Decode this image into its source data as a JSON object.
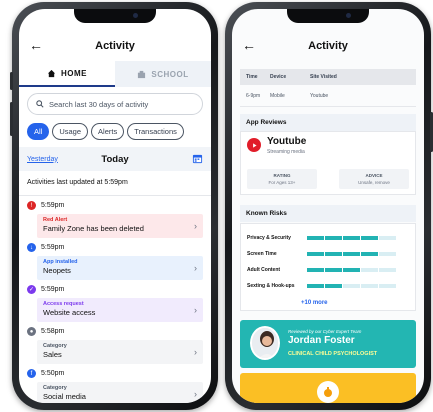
{
  "left": {
    "header": {
      "title": "Activity"
    },
    "tabs": [
      {
        "label": "HOME"
      },
      {
        "label": "SCHOOL"
      }
    ],
    "search": {
      "placeholder": "Search last 30 days of activity"
    },
    "filters": [
      "All",
      "Usage",
      "Alerts",
      "Transactions"
    ],
    "date_nav": {
      "prev": "Yesterday",
      "current": "Today"
    },
    "updated_text": "Activities last updated at 5:59pm",
    "feed": [
      {
        "time": "5:59pm",
        "label": "Red Alert",
        "value": "Family Zone has been deleted",
        "color": "#dc2626",
        "bg": "#fde8ea"
      },
      {
        "time": "5:59pm",
        "label": "App installed",
        "value": "Neopets",
        "color": "#2563eb",
        "bg": "#e8f1fd"
      },
      {
        "time": "5:59pm",
        "label": "Access request",
        "value": "Website access",
        "color": "#7c3aed",
        "bg": "#f1ebfd"
      },
      {
        "time": "5:58pm",
        "label": "Category",
        "value": "Sales",
        "color": "#6b7280",
        "bg": "#f3f4f6"
      },
      {
        "time": "5:50pm",
        "label": "Category",
        "value": "Social media",
        "color": "#2563eb",
        "bg": "#f3f4f6"
      }
    ]
  },
  "right": {
    "header": {
      "title": "Activity"
    },
    "table": {
      "headers": [
        "Time",
        "Device",
        "Site Visited"
      ],
      "rows": [
        [
          "6-9pm",
          "Mobile",
          "Youtube"
        ]
      ]
    },
    "reviews": {
      "heading": "App Reviews",
      "app_name": "Youtube",
      "app_sub": "Streaming media",
      "rating_h": "RATING",
      "rating_v": "For Ages 13+",
      "advice_h": "ADVICE",
      "advice_v": "Unsafe, remove"
    },
    "risks": {
      "heading": "Known Risks",
      "items": [
        {
          "name": "Privacy & Security",
          "level": 4
        },
        {
          "name": "Screen Time",
          "level": 4
        },
        {
          "name": "Adult Content",
          "level": 3
        },
        {
          "name": "Sexting & Hook-ups",
          "level": 2
        }
      ],
      "max_level": 5,
      "more": "+10 more"
    },
    "expert": {
      "tag": "Reviewed by our Cyber Expert Team",
      "name": "Jordan Foster",
      "role": "CLINICAL CHILD PSYCHOLOGIST"
    }
  }
}
